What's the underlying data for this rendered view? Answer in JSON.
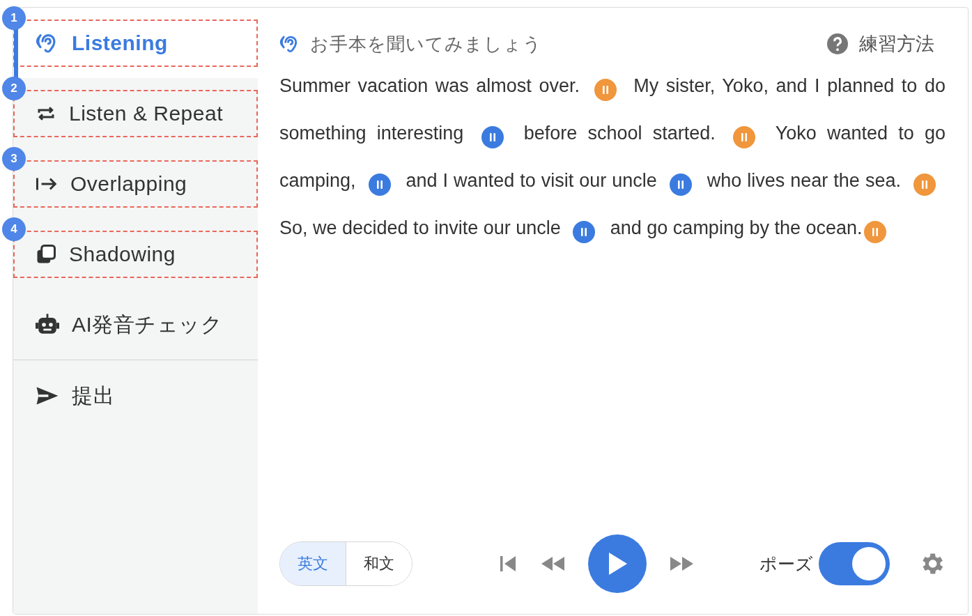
{
  "sidebar": {
    "items": [
      {
        "label": "Listening",
        "selected": true,
        "marker": "1"
      },
      {
        "label": "Listen & Repeat",
        "selected": false,
        "marker": "2"
      },
      {
        "label": "Overlapping",
        "selected": false,
        "marker": "3"
      },
      {
        "label": "Shadowing",
        "selected": false,
        "marker": "4"
      },
      {
        "label": "AI発音チェック",
        "selected": false
      }
    ],
    "submit": {
      "label": "提出"
    }
  },
  "header": {
    "title": "お手本を聞いてみましょう",
    "help": "練習方法"
  },
  "passage": [
    {
      "text": "Summer vacation was almost over.",
      "color": "#f0963c"
    },
    {
      "text": "My sister, Yoko, and I planned to do something interesting",
      "color": "#3b7be0"
    },
    {
      "text": "before school started.",
      "color": "#f0963c"
    },
    {
      "text": "Yoko wanted to go camping,",
      "color": "#3b7be0"
    },
    {
      "text": "and I wanted to visit our uncle",
      "color": "#3b7be0"
    },
    {
      "text": "who lives near the sea.",
      "color": "#f0963c"
    },
    {
      "text": "So, we decided to invite our uncle",
      "color": "#3b7be0"
    },
    {
      "text": "and go camping by the ocean.",
      "color": "#f0963c"
    }
  ],
  "player": {
    "languages": [
      {
        "label": "英文",
        "selected": true
      },
      {
        "label": "和文",
        "selected": false
      }
    ],
    "pause": {
      "label": "ポーズ",
      "on": true
    }
  }
}
